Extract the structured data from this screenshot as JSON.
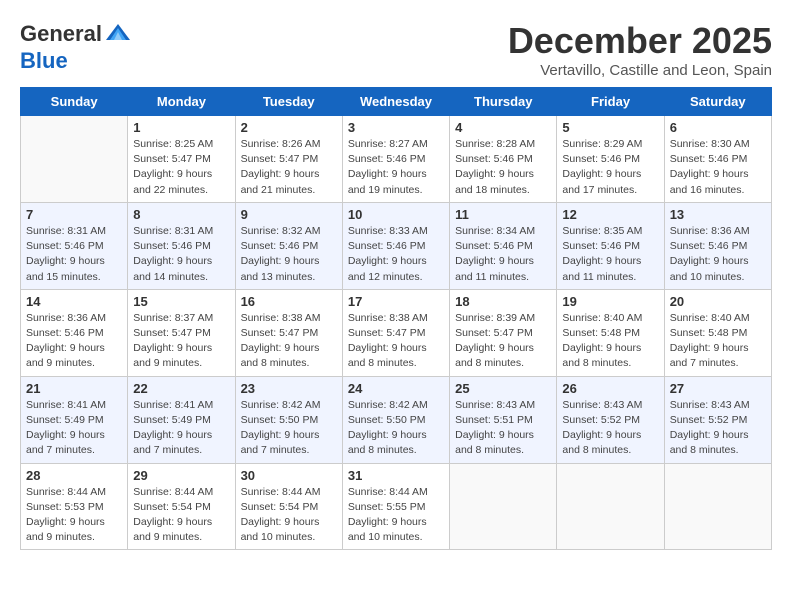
{
  "header": {
    "logo_general": "General",
    "logo_blue": "Blue",
    "month_title": "December 2025",
    "location": "Vertavillo, Castille and Leon, Spain"
  },
  "weekdays": [
    "Sunday",
    "Monday",
    "Tuesday",
    "Wednesday",
    "Thursday",
    "Friday",
    "Saturday"
  ],
  "weeks": [
    [
      {
        "day": "",
        "sunrise": "",
        "sunset": "",
        "daylight": ""
      },
      {
        "day": "1",
        "sunrise": "Sunrise: 8:25 AM",
        "sunset": "Sunset: 5:47 PM",
        "daylight": "Daylight: 9 hours and 22 minutes."
      },
      {
        "day": "2",
        "sunrise": "Sunrise: 8:26 AM",
        "sunset": "Sunset: 5:47 PM",
        "daylight": "Daylight: 9 hours and 21 minutes."
      },
      {
        "day": "3",
        "sunrise": "Sunrise: 8:27 AM",
        "sunset": "Sunset: 5:46 PM",
        "daylight": "Daylight: 9 hours and 19 minutes."
      },
      {
        "day": "4",
        "sunrise": "Sunrise: 8:28 AM",
        "sunset": "Sunset: 5:46 PM",
        "daylight": "Daylight: 9 hours and 18 minutes."
      },
      {
        "day": "5",
        "sunrise": "Sunrise: 8:29 AM",
        "sunset": "Sunset: 5:46 PM",
        "daylight": "Daylight: 9 hours and 17 minutes."
      },
      {
        "day": "6",
        "sunrise": "Sunrise: 8:30 AM",
        "sunset": "Sunset: 5:46 PM",
        "daylight": "Daylight: 9 hours and 16 minutes."
      }
    ],
    [
      {
        "day": "7",
        "sunrise": "Sunrise: 8:31 AM",
        "sunset": "Sunset: 5:46 PM",
        "daylight": "Daylight: 9 hours and 15 minutes."
      },
      {
        "day": "8",
        "sunrise": "Sunrise: 8:31 AM",
        "sunset": "Sunset: 5:46 PM",
        "daylight": "Daylight: 9 hours and 14 minutes."
      },
      {
        "day": "9",
        "sunrise": "Sunrise: 8:32 AM",
        "sunset": "Sunset: 5:46 PM",
        "daylight": "Daylight: 9 hours and 13 minutes."
      },
      {
        "day": "10",
        "sunrise": "Sunrise: 8:33 AM",
        "sunset": "Sunset: 5:46 PM",
        "daylight": "Daylight: 9 hours and 12 minutes."
      },
      {
        "day": "11",
        "sunrise": "Sunrise: 8:34 AM",
        "sunset": "Sunset: 5:46 PM",
        "daylight": "Daylight: 9 hours and 11 minutes."
      },
      {
        "day": "12",
        "sunrise": "Sunrise: 8:35 AM",
        "sunset": "Sunset: 5:46 PM",
        "daylight": "Daylight: 9 hours and 11 minutes."
      },
      {
        "day": "13",
        "sunrise": "Sunrise: 8:36 AM",
        "sunset": "Sunset: 5:46 PM",
        "daylight": "Daylight: 9 hours and 10 minutes."
      }
    ],
    [
      {
        "day": "14",
        "sunrise": "Sunrise: 8:36 AM",
        "sunset": "Sunset: 5:46 PM",
        "daylight": "Daylight: 9 hours and 9 minutes."
      },
      {
        "day": "15",
        "sunrise": "Sunrise: 8:37 AM",
        "sunset": "Sunset: 5:47 PM",
        "daylight": "Daylight: 9 hours and 9 minutes."
      },
      {
        "day": "16",
        "sunrise": "Sunrise: 8:38 AM",
        "sunset": "Sunset: 5:47 PM",
        "daylight": "Daylight: 9 hours and 8 minutes."
      },
      {
        "day": "17",
        "sunrise": "Sunrise: 8:38 AM",
        "sunset": "Sunset: 5:47 PM",
        "daylight": "Daylight: 9 hours and 8 minutes."
      },
      {
        "day": "18",
        "sunrise": "Sunrise: 8:39 AM",
        "sunset": "Sunset: 5:47 PM",
        "daylight": "Daylight: 9 hours and 8 minutes."
      },
      {
        "day": "19",
        "sunrise": "Sunrise: 8:40 AM",
        "sunset": "Sunset: 5:48 PM",
        "daylight": "Daylight: 9 hours and 8 minutes."
      },
      {
        "day": "20",
        "sunrise": "Sunrise: 8:40 AM",
        "sunset": "Sunset: 5:48 PM",
        "daylight": "Daylight: 9 hours and 7 minutes."
      }
    ],
    [
      {
        "day": "21",
        "sunrise": "Sunrise: 8:41 AM",
        "sunset": "Sunset: 5:49 PM",
        "daylight": "Daylight: 9 hours and 7 minutes."
      },
      {
        "day": "22",
        "sunrise": "Sunrise: 8:41 AM",
        "sunset": "Sunset: 5:49 PM",
        "daylight": "Daylight: 9 hours and 7 minutes."
      },
      {
        "day": "23",
        "sunrise": "Sunrise: 8:42 AM",
        "sunset": "Sunset: 5:50 PM",
        "daylight": "Daylight: 9 hours and 7 minutes."
      },
      {
        "day": "24",
        "sunrise": "Sunrise: 8:42 AM",
        "sunset": "Sunset: 5:50 PM",
        "daylight": "Daylight: 9 hours and 8 minutes."
      },
      {
        "day": "25",
        "sunrise": "Sunrise: 8:43 AM",
        "sunset": "Sunset: 5:51 PM",
        "daylight": "Daylight: 9 hours and 8 minutes."
      },
      {
        "day": "26",
        "sunrise": "Sunrise: 8:43 AM",
        "sunset": "Sunset: 5:52 PM",
        "daylight": "Daylight: 9 hours and 8 minutes."
      },
      {
        "day": "27",
        "sunrise": "Sunrise: 8:43 AM",
        "sunset": "Sunset: 5:52 PM",
        "daylight": "Daylight: 9 hours and 8 minutes."
      }
    ],
    [
      {
        "day": "28",
        "sunrise": "Sunrise: 8:44 AM",
        "sunset": "Sunset: 5:53 PM",
        "daylight": "Daylight: 9 hours and 9 minutes."
      },
      {
        "day": "29",
        "sunrise": "Sunrise: 8:44 AM",
        "sunset": "Sunset: 5:54 PM",
        "daylight": "Daylight: 9 hours and 9 minutes."
      },
      {
        "day": "30",
        "sunrise": "Sunrise: 8:44 AM",
        "sunset": "Sunset: 5:54 PM",
        "daylight": "Daylight: 9 hours and 10 minutes."
      },
      {
        "day": "31",
        "sunrise": "Sunrise: 8:44 AM",
        "sunset": "Sunset: 5:55 PM",
        "daylight": "Daylight: 9 hours and 10 minutes."
      },
      {
        "day": "",
        "sunrise": "",
        "sunset": "",
        "daylight": ""
      },
      {
        "day": "",
        "sunrise": "",
        "sunset": "",
        "daylight": ""
      },
      {
        "day": "",
        "sunrise": "",
        "sunset": "",
        "daylight": ""
      }
    ]
  ]
}
